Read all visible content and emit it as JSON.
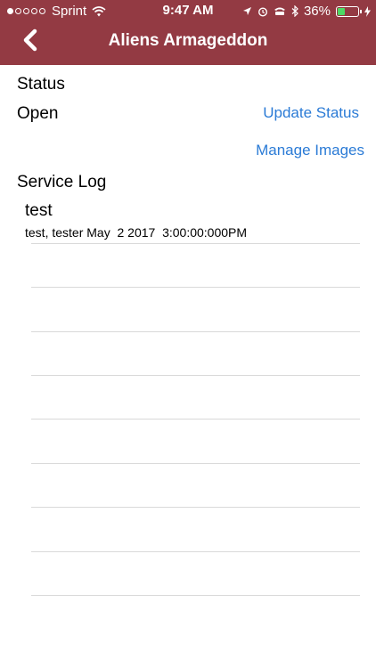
{
  "status_bar": {
    "carrier": "Sprint",
    "time": "9:47 AM",
    "battery_percent": "36%",
    "battery_level": 0.36,
    "signal_dots_filled": 1,
    "signal_dots_total": 5,
    "icons": [
      "wifi-icon",
      "location-arrow-icon",
      "alarm-icon",
      "tty-icon",
      "bluetooth-icon",
      "battery-icon",
      "charging-bolt-icon"
    ]
  },
  "nav": {
    "title": "Aliens Armageddon",
    "back_icon": "chevron-left-icon",
    "bar_color": "#933a43"
  },
  "status": {
    "heading": "Status",
    "value": "Open",
    "update_link": "Update Status"
  },
  "images": {
    "manage_link": "Manage Images"
  },
  "service_log": {
    "heading": "Service Log",
    "entries": [
      {
        "title": "test",
        "meta": "test, tester May  2 2017  3:00:00:000PM"
      }
    ],
    "empty_rows": 9
  },
  "colors": {
    "link": "#2b7bd6",
    "divider": "#d9d9d9"
  }
}
